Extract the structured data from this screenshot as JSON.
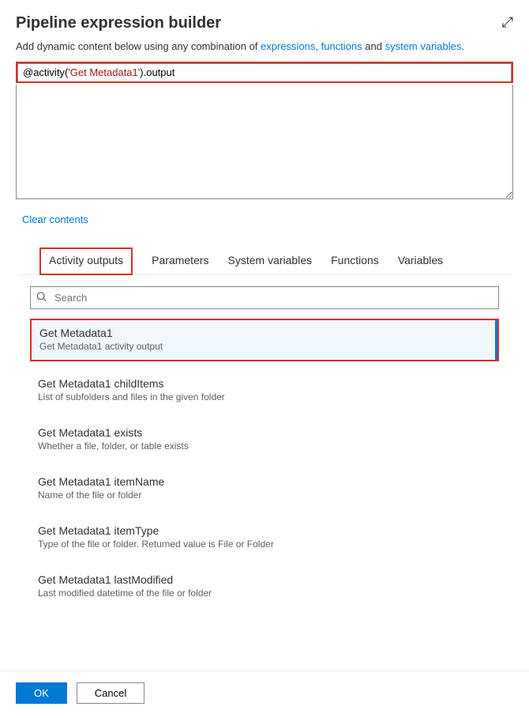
{
  "header": {
    "title": "Pipeline expression builder",
    "subtitle_prefix": "Add dynamic content below using any combination of ",
    "link_expressions": "expressions, functions",
    "subtitle_mid": " and ",
    "link_sysvars": "system variables",
    "subtitle_suffix": "."
  },
  "expression": {
    "at": "@",
    "fn": "activity",
    "open": "(",
    "str": "'Get Metadata1'",
    "close": ")",
    "dot": ".",
    "prop": "output",
    "value": "@activity('Get Metadata1').output",
    "clear_label": "Clear contents"
  },
  "tabs": {
    "items": [
      {
        "label": "Activity outputs"
      },
      {
        "label": "Parameters"
      },
      {
        "label": "System variables"
      },
      {
        "label": "Functions"
      },
      {
        "label": "Variables"
      }
    ]
  },
  "search": {
    "placeholder": "Search"
  },
  "outputs": [
    {
      "title": "Get Metadata1",
      "desc": "Get Metadata1 activity output",
      "selected": true
    },
    {
      "title": "Get Metadata1 childItems",
      "desc": "List of subfolders and files in the given folder"
    },
    {
      "title": "Get Metadata1 exists",
      "desc": "Whether a file, folder, or table exists"
    },
    {
      "title": "Get Metadata1 itemName",
      "desc": "Name of the file or folder"
    },
    {
      "title": "Get Metadata1 itemType",
      "desc": "Type of the file or folder. Returned value is File or Folder"
    },
    {
      "title": "Get Metadata1 lastModified",
      "desc": "Last modified datetime of the file or folder"
    }
  ],
  "footer": {
    "ok": "OK",
    "cancel": "Cancel"
  }
}
